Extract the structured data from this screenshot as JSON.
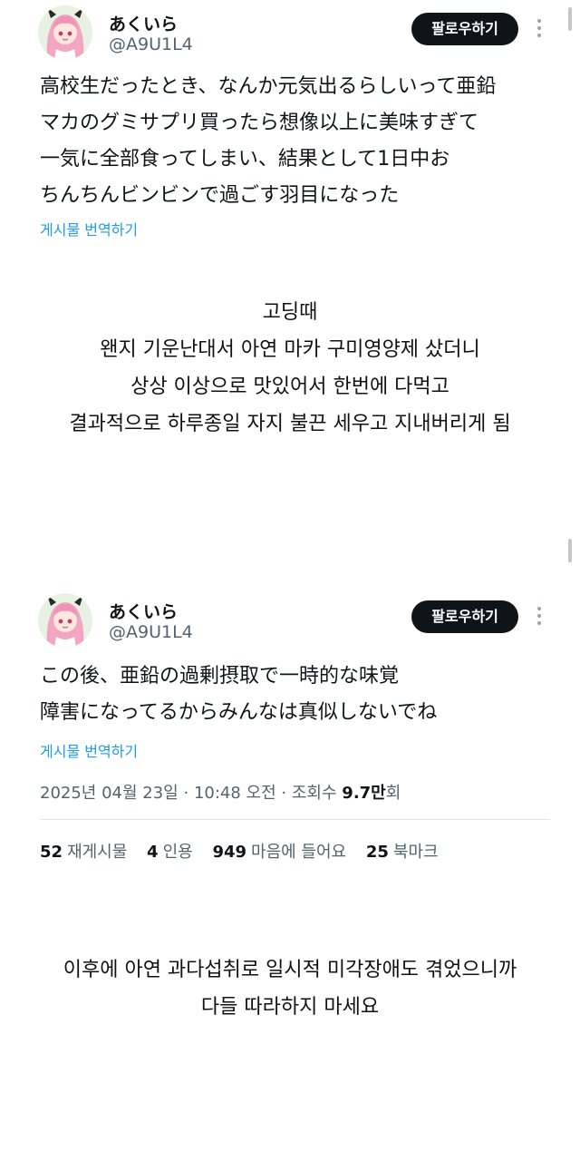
{
  "post1": {
    "display_name": "あくいら",
    "handle": "@A9U1L4",
    "follow_label": "팔로우하기",
    "lines": [
      "高校生だったとき、なんか元気出るらしいって亜鉛",
      "マカのグミサプリ買ったら想像以上に美味すぎて",
      "一気に全部食ってしまい、結果として1日中お",
      "ちんちんビンビンで過ごす羽目になった"
    ],
    "translate_label": "게시물 번역하기"
  },
  "caption1": {
    "lines": [
      "고딩때",
      "왠지 기운난대서 아연 마카 구미영양제 샀더니",
      "상상 이상으로 맛있어서 한번에 다먹고",
      "결과적으로 하루종일 자지 불끈 세우고 지내버리게 됨"
    ]
  },
  "post2": {
    "display_name": "あくいら",
    "handle": "@A9U1L4",
    "follow_label": "팔로우하기",
    "lines": [
      "この後、亜鉛の過剰摂取で一時的な味覚",
      "障害になってるからみんなは真似しないでね"
    ],
    "translate_label": "게시물 번역하기",
    "meta": {
      "date": "2025년 04월 23일",
      "separator": "·",
      "time": "10:48 오전",
      "views_label": "조회수",
      "views_value": "9.7만",
      "views_suffix": "회"
    },
    "stats": {
      "reposts_count": "52",
      "reposts_label": "재게시물",
      "quotes_count": "4",
      "quotes_label": "인용",
      "likes_count": "949",
      "likes_label": "마음에 들어요",
      "bookmarks_count": "25",
      "bookmarks_label": "북마크"
    }
  },
  "caption2": {
    "lines": [
      "이후에 아연 과다섭취로 일시적 미각장애도 겪었으니까",
      "다들 따라하지 마세요"
    ]
  },
  "icons": {
    "avatar": "anime-avatar-pink-hair",
    "more": "more-vertical-icon"
  },
  "colors": {
    "handle": "#536471",
    "link": "#1d9bf0",
    "button_bg": "#0f1419",
    "button_text": "#ffffff"
  }
}
